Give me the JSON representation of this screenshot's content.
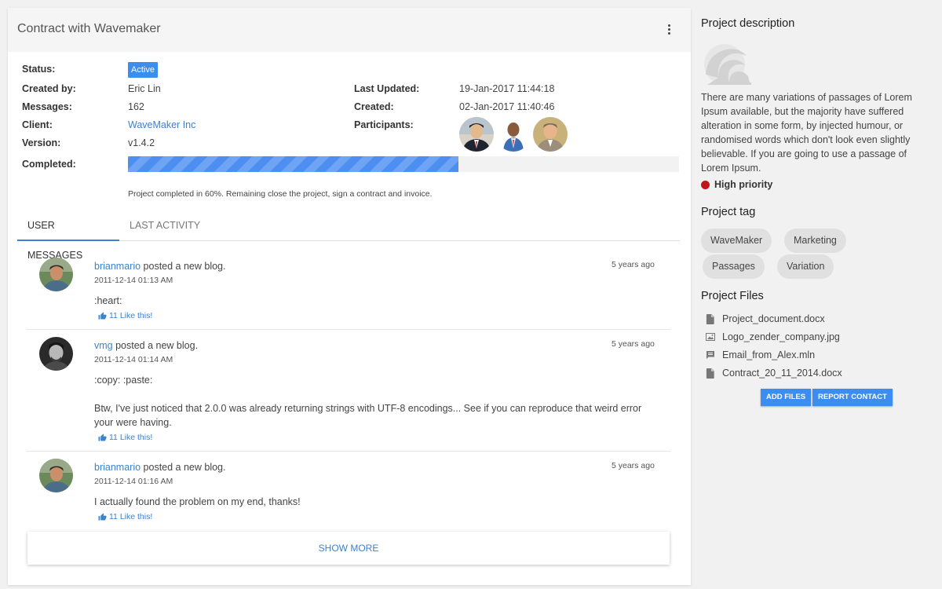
{
  "card": {
    "title": "Contract with Wavemaker"
  },
  "details": {
    "status_label": "Status:",
    "status_value": "Active",
    "created_by_label": "Created by:",
    "created_by_value": "Eric Lin",
    "messages_label": "Messages:",
    "messages_value": "162",
    "client_label": "Client:",
    "client_value": "WaveMaker Inc",
    "version_label": "Version:",
    "version_value": "v1.4.2",
    "last_updated_label": "Last Updated:",
    "last_updated_value": "19-Jan-2017 11:44:18",
    "created_label": "Created:",
    "created_value": "02-Jan-2017 11:40:46",
    "participants_label": "Participants:",
    "completed_label": "Completed:",
    "completed_percent": 60,
    "progress_note": "Project completed in 60%. Remaining close the project, sign a contract and invoice."
  },
  "tabs": {
    "user_messages": "USER MESSAGES",
    "last_activity": "LAST ACTIVITY"
  },
  "messages": [
    {
      "user": "brianmario",
      "action": " posted a new blog.",
      "date": "2011-12-14 01:13 AM",
      "ago": "5 years ago",
      "body": ":heart:",
      "likes": "11 Like this!"
    },
    {
      "user": "vmg",
      "action": " posted a new blog.",
      "date": "2011-12-14 01:14 AM",
      "ago": "5 years ago",
      "body": ":copy: :paste:\n\nBtw, I've just noticed that 2.0.0 was already returning strings with UTF-8 encodings... See if you can reproduce that weird error your were having.",
      "likes": "11 Like this!"
    },
    {
      "user": "brianmario",
      "action": " posted a new blog.",
      "date": "2011-12-14 01:16 AM",
      "ago": "5 years ago",
      "body": "I actually found the problem on my end, thanks!",
      "likes": "11 Like this!"
    }
  ],
  "show_more": "SHOW MORE",
  "sidebar": {
    "description_title": "Project description",
    "description_text": "There are many variations of passages of Lorem Ipsum available, but the majority have suffered alteration in some form, by injected humour, or randomised words which don't look even slightly believable. If you are going to use a passage of Lorem Ipsum.",
    "priority": "High priority",
    "priority_color": "#c0151b",
    "tag_title": "Project tag",
    "tags": [
      "WaveMaker",
      "Marketing",
      "Passages",
      "Variation"
    ],
    "files_title": "Project Files",
    "files": [
      {
        "name": "Project_document.docx",
        "icon": "document-icon"
      },
      {
        "name": "Logo_zender_company.jpg",
        "icon": "image-icon"
      },
      {
        "name": "Email_from_Alex.mln",
        "icon": "comment-icon"
      },
      {
        "name": "Contract_20_11_2014.docx",
        "icon": "document-icon"
      }
    ],
    "add_files": "ADD FILES",
    "report_contact": "REPORT CONTACT"
  },
  "colors": {
    "accent": "#3b8ef0",
    "link": "#3b82d0"
  }
}
